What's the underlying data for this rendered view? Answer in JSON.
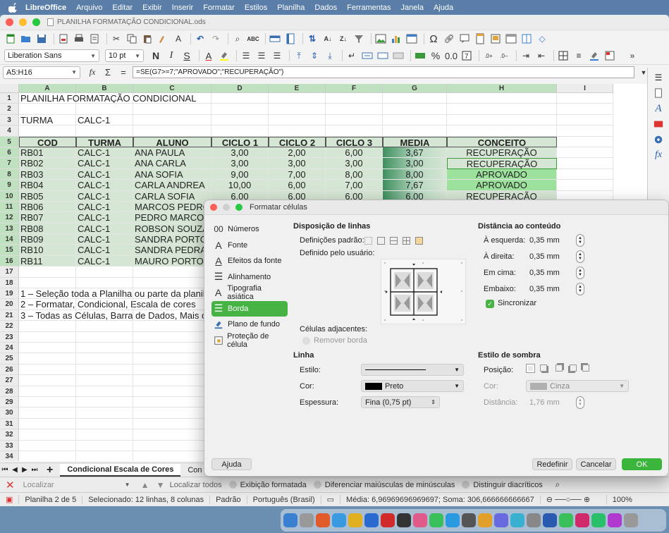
{
  "menubar": {
    "app": "LibreOffice",
    "items": [
      "Arquivo",
      "Editar",
      "Exibir",
      "Inserir",
      "Formatar",
      "Estilos",
      "Planilha",
      "Dados",
      "Ferramentas",
      "Janela",
      "Ajuda"
    ]
  },
  "window": {
    "title": "PLANILHA FORMATAÇÃO CONDICIONAL.ods"
  },
  "format_toolbar": {
    "font_name": "Liberation Sans",
    "font_size": "10 pt"
  },
  "formula_bar": {
    "name_box": "A5:H16",
    "formula": "=SE(G7>=7;\"APROVADO\";\"RECUPERAÇÃO\")"
  },
  "sheet": {
    "columns": [
      "A",
      "B",
      "C",
      "D",
      "E",
      "F",
      "G",
      "H",
      "I"
    ],
    "rows": [
      {
        "n": "1",
        "cells": [
          "PLANILHA FORMATAÇÃO CONDICIONAL",
          "",
          "",
          "",
          "",
          "",
          "",
          ""
        ]
      },
      {
        "n": "2",
        "cells": [
          "",
          "",
          "",
          "",
          "",
          "",
          "",
          ""
        ]
      },
      {
        "n": "3",
        "cells": [
          "TURMA",
          "CALC-1",
          "",
          "",
          "",
          "",
          "",
          ""
        ]
      },
      {
        "n": "4",
        "cells": [
          "",
          "",
          "",
          "",
          "",
          "",
          "",
          ""
        ]
      },
      {
        "n": "5",
        "cells": [
          "COD",
          "TURMA",
          "ALUNO",
          "CICLO 1",
          "CICLO 2",
          "CICLO 3",
          "MEDIA",
          "CONCEITO"
        ]
      },
      {
        "n": "6",
        "cells": [
          "RB01",
          "CALC-1",
          "ANA PAULA",
          "3,00",
          "2,00",
          "6,00",
          "3,67",
          "RECUPERAÇÃO"
        ]
      },
      {
        "n": "7",
        "cells": [
          "RB02",
          "CALC-1",
          "ANA CARLA",
          "3,00",
          "3,00",
          "3,00",
          "3,00",
          "RECUPERAÇÃO"
        ]
      },
      {
        "n": "8",
        "cells": [
          "RB03",
          "CALC-1",
          "ANA SOFIA",
          "9,00",
          "7,00",
          "8,00",
          "8,00",
          "APROVADO"
        ]
      },
      {
        "n": "9",
        "cells": [
          "RB04",
          "CALC-1",
          "CARLA ANDREA",
          "10,00",
          "6,00",
          "7,00",
          "7,67",
          "APROVADO"
        ]
      },
      {
        "n": "10",
        "cells": [
          "RB05",
          "CALC-1",
          "CARLA SOFIA",
          "6,00",
          "6,00",
          "6,00",
          "6,00",
          "RECUPERAÇÃO"
        ]
      },
      {
        "n": "11",
        "cells": [
          "RB06",
          "CALC-1",
          "MARCOS PEDRO",
          "",
          "",
          "",
          "",
          ""
        ]
      },
      {
        "n": "12",
        "cells": [
          "RB07",
          "CALC-1",
          "PEDRO MARCOS",
          "",
          "",
          "",
          "",
          ""
        ]
      },
      {
        "n": "13",
        "cells": [
          "RB08",
          "CALC-1",
          "ROBSON SOUZA",
          "",
          "",
          "",
          "",
          ""
        ]
      },
      {
        "n": "14",
        "cells": [
          "RB09",
          "CALC-1",
          "SANDRA PORTO",
          "",
          "",
          "",
          "",
          ""
        ]
      },
      {
        "n": "15",
        "cells": [
          "RB10",
          "CALC-1",
          "SANDRA PEDRA",
          "",
          "",
          "",
          "",
          ""
        ]
      },
      {
        "n": "16",
        "cells": [
          "RB11",
          "CALC-1",
          "MAURO PORTO",
          "",
          "",
          "",
          "",
          ""
        ]
      },
      {
        "n": "17",
        "cells": [
          "",
          "",
          "",
          "",
          "",
          "",
          "",
          ""
        ]
      },
      {
        "n": "18",
        "cells": [
          "",
          "",
          "",
          "",
          "",
          "",
          "",
          ""
        ]
      },
      {
        "n": "19",
        "cells": [
          "1 – Seleção toda a Planilha ou parte da planilh",
          "",
          "",
          "",
          "",
          "",
          "",
          ""
        ]
      },
      {
        "n": "20",
        "cells": [
          "2 – Formatar, Condicional, Escala de cores",
          "",
          "",
          "",
          "",
          "",
          "",
          ""
        ]
      },
      {
        "n": "21",
        "cells": [
          "3 – Todas as Células, Barra de Dados, Mais op",
          "",
          "",
          "",
          "",
          "",
          "",
          ""
        ]
      },
      {
        "n": "22",
        "cells": [
          "",
          "",
          "",
          "",
          "",
          "",
          "",
          ""
        ]
      },
      {
        "n": "23",
        "cells": [
          "",
          "",
          "",
          "",
          "",
          "",
          "",
          ""
        ]
      },
      {
        "n": "24",
        "cells": [
          "",
          "",
          "",
          "",
          "",
          "",
          "",
          ""
        ]
      },
      {
        "n": "25",
        "cells": [
          "",
          "",
          "",
          "",
          "",
          "",
          "",
          ""
        ]
      },
      {
        "n": "26",
        "cells": [
          "",
          "",
          "",
          "",
          "",
          "",
          "",
          ""
        ]
      },
      {
        "n": "27",
        "cells": [
          "",
          "",
          "",
          "",
          "",
          "",
          "",
          ""
        ]
      },
      {
        "n": "28",
        "cells": [
          "",
          "",
          "",
          "",
          "",
          "",
          "",
          ""
        ]
      },
      {
        "n": "29",
        "cells": [
          "",
          "",
          "",
          "",
          "",
          "",
          "",
          ""
        ]
      },
      {
        "n": "30",
        "cells": [
          "",
          "",
          "",
          "",
          "",
          "",
          "",
          ""
        ]
      },
      {
        "n": "31",
        "cells": [
          "",
          "",
          "",
          "",
          "",
          "",
          "",
          ""
        ]
      },
      {
        "n": "32",
        "cells": [
          "",
          "",
          "",
          "",
          "",
          "",
          "",
          ""
        ]
      },
      {
        "n": "33",
        "cells": [
          "",
          "",
          "",
          "",
          "",
          "",
          "",
          ""
        ]
      },
      {
        "n": "34",
        "cells": [
          "",
          "",
          "",
          "",
          "",
          "",
          "",
          ""
        ]
      }
    ]
  },
  "sheet_tabs": {
    "active": "Condicional Escala de Cores",
    "next": "Con"
  },
  "find_bar": {
    "placeholder": "Localizar",
    "find_all": "Localizar todos",
    "formatted": "Exibição formatada",
    "match_case": "Diferenciar maiúsculas de minúsculas",
    "diacritics": "Distinguir diacríticos"
  },
  "status_bar": {
    "sheet": "Planilha 2 de 5",
    "selection": "Selecionado: 12 linhas, 8 colunas",
    "style": "Padrão",
    "language": "Português (Brasil)",
    "sum": "Média: 6,96969696969697; Soma: 306,666666666667",
    "zoom": "100%"
  },
  "dialog": {
    "title": "Formatar células",
    "nav": [
      {
        "label": "Números",
        "icon": "numbers-icon"
      },
      {
        "label": "Fonte",
        "icon": "font-icon"
      },
      {
        "label": "Efeitos da fonte",
        "icon": "font-effects-icon"
      },
      {
        "label": "Alinhamento",
        "icon": "alignment-icon"
      },
      {
        "label": "Tipografia asiática",
        "icon": "asian-typography-icon"
      },
      {
        "label": "Borda",
        "icon": "borders-icon"
      },
      {
        "label": "Plano de fundo",
        "icon": "background-icon"
      },
      {
        "label": "Proteção de célula",
        "icon": "cell-protection-icon"
      }
    ],
    "line_arrangement": {
      "heading": "Disposição de linhas",
      "presets": "Definições padrão:",
      "user_defined": "Definido pelo usuário:",
      "adjacent": "Células adjacentes:",
      "remove_border": "Remover borda"
    },
    "padding": {
      "heading": "Distância ao conteúdo",
      "left_label": "À esquerda:",
      "left": "0,35 mm",
      "right_label": "À direita:",
      "right": "0,35 mm",
      "top_label": "Em cima:",
      "top": "0,35 mm",
      "bottom_label": "Embaixo:",
      "bottom": "0,35 mm",
      "sync": "Sincronizar"
    },
    "line": {
      "heading": "Linha",
      "style_label": "Estilo:",
      "color_label": "Cor:",
      "color": "Preto",
      "width_label": "Espessura:",
      "width": "Fina (0,75 pt)"
    },
    "shadow": {
      "heading": "Estilo de sombra",
      "position_label": "Posição:",
      "color_label": "Cor:",
      "color": "Cinza",
      "distance_label": "Distância:",
      "distance": "1,76 mm"
    },
    "buttons": {
      "help": "Ajuda",
      "reset": "Redefinir",
      "cancel": "Cancelar",
      "ok": "OK"
    }
  },
  "colors": {
    "accent_green": "#46b344",
    "header_green": "#bfe1bf",
    "approved_green": "#9ce29c"
  }
}
